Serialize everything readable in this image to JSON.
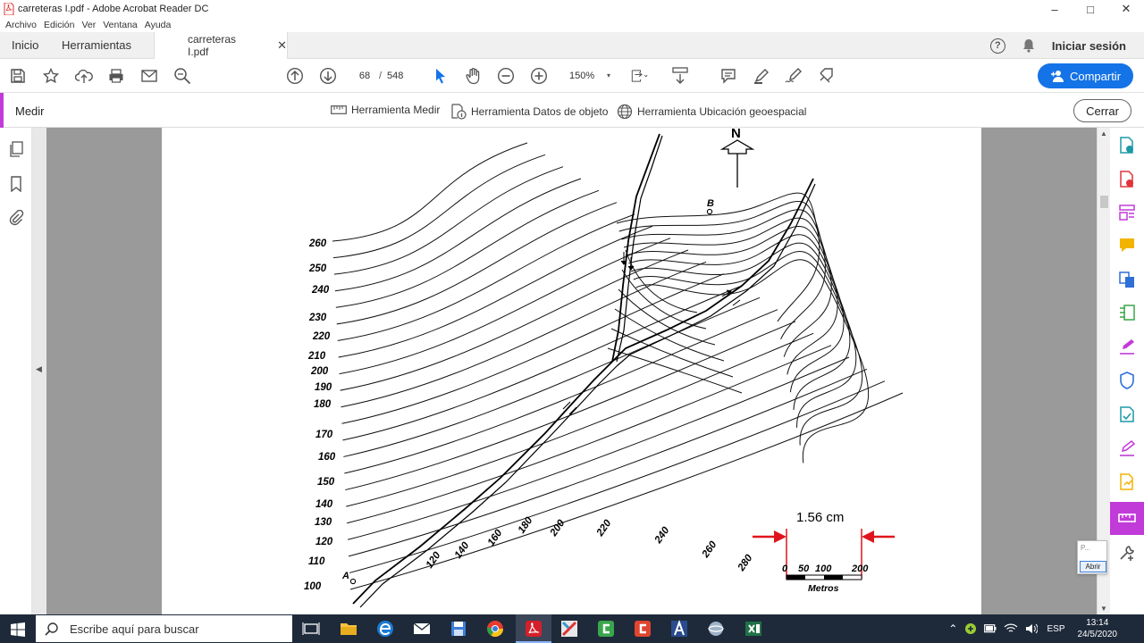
{
  "window": {
    "title": "carreteras I.pdf - Adobe Acrobat Reader DC",
    "min": "–",
    "max": "□",
    "close": "✕"
  },
  "menu": [
    "Archivo",
    "Edición",
    "Ver",
    "Ventana",
    "Ayuda"
  ],
  "tabs": {
    "home": "Inicio",
    "tools": "Herramientas",
    "document": "carreteras I.pdf",
    "close": "✕"
  },
  "header": {
    "help": "?",
    "signin": "Iniciar sesión"
  },
  "toolbar": {
    "page_current": "68",
    "page_sep": "/",
    "page_total": "548",
    "zoom": "150%",
    "zoom_caret": "▾",
    "share_label": "Compartir"
  },
  "measure_panel": {
    "title": "Medir",
    "tools": [
      "Herramienta Medir",
      "Herramienta Datos de objeto",
      "Herramienta Ubicación geoespacial"
    ],
    "close_label": "Cerrar"
  },
  "map": {
    "north": "N",
    "point_b": "B",
    "point_a": "A",
    "left_labels": [
      "260",
      "250",
      "240",
      "230",
      "220",
      "210",
      "200",
      "190",
      "180",
      "170",
      "160",
      "150",
      "140",
      "130",
      "120",
      "110",
      "100"
    ],
    "bottom_labels": [
      "120",
      "140",
      "160",
      "180",
      "200",
      "220",
      "240",
      "260",
      "280"
    ],
    "measurement": "1.56 cm",
    "scale_ticks": [
      "0",
      "50",
      "100",
      "200"
    ],
    "scale_unit": "Metros"
  },
  "popup": {
    "text": "P...",
    "button": "Abrir"
  },
  "taskbar": {
    "search_placeholder": "Escribe aquí para buscar",
    "lang": "ESP",
    "time": "13:14",
    "date": "24/5/2020"
  }
}
